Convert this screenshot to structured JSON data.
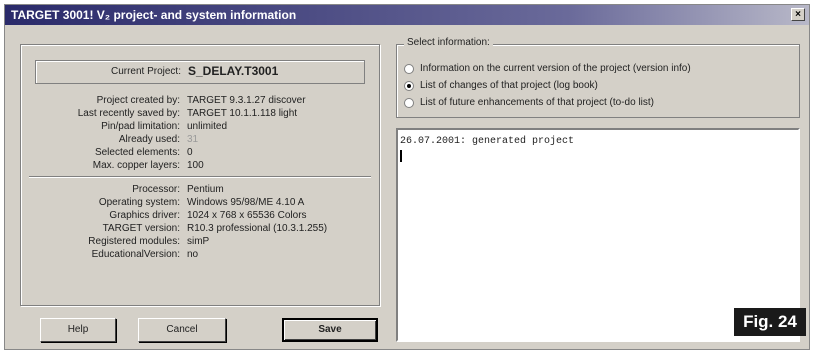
{
  "window": {
    "title": "TARGET 3001! V₂  project- and system information",
    "close_label": "×"
  },
  "project": {
    "current_label": "Current Project:",
    "current_value": "S_DELAY.T3001",
    "fields": [
      {
        "label": "Project created by:",
        "value": "TARGET 9.3.1.27 discover"
      },
      {
        "label": "Last recently saved by:",
        "value": "TARGET 10.1.1.118 light"
      },
      {
        "label": "Pin/pad limitation:",
        "value": "unlimited"
      },
      {
        "label": "Already used:",
        "value": "31"
      },
      {
        "label": "Selected elements:",
        "value": "0"
      },
      {
        "label": "Max. copper layers:",
        "value": "100"
      }
    ]
  },
  "system": {
    "fields": [
      {
        "label": "Processor:",
        "value": "Pentium"
      },
      {
        "label": "Operating system:",
        "value": "Windows 95/98/ME 4.10 A"
      },
      {
        "label": "Graphics driver:",
        "value": "1024 x 768 x 65536 Colors"
      },
      {
        "label": "TARGET version:",
        "value": "R10.3 professional  (10.3.1.255)"
      },
      {
        "label": "Registered modules:",
        "value": "simP"
      },
      {
        "label": "EducationalVersion:",
        "value": "no"
      }
    ]
  },
  "buttons": {
    "help": "Help",
    "cancel": "Cancel",
    "save": "Save"
  },
  "select_info": {
    "label": "Select information:",
    "options": [
      "Information on the current version of the project (version info)",
      "List of changes of that project (log book)",
      "List of future enhancements of that project (to-do list)"
    ],
    "selected_index": 1
  },
  "log": {
    "lines": [
      "26.07.2001: generated project"
    ]
  },
  "figure_label": "Fig. 24"
}
